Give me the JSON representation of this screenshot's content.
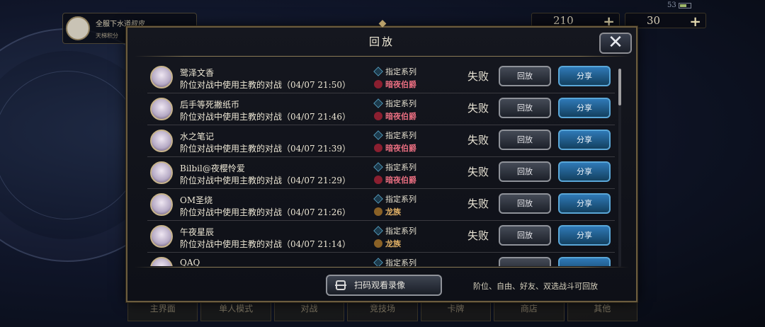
{
  "background": {
    "player_title": "全服下水道叔皮",
    "player_sub": "天梯积分",
    "currency": [
      {
        "name": "gold",
        "value": "210"
      },
      {
        "name": "crystal",
        "value": "30"
      }
    ],
    "battery": "53",
    "nav": [
      "主界面",
      "单人模式",
      "对战",
      "竞技场",
      "卡牌",
      "商店",
      "其他"
    ]
  },
  "dialog": {
    "title": "回放",
    "close_icon": "close-icon",
    "replay_label": "回放",
    "share_label": "分享",
    "qr_button": "扫码观看录像",
    "hint": "阶位、自由、好友、双选战斗可回放"
  },
  "replays": [
    {
      "name": "鹭泽文香",
      "desc": "阶位对战中使用主教的对战（04/07 21:50）",
      "deck": "指定系列",
      "opponent": "暗夜伯爵",
      "opp_type": "bat",
      "result": "失败"
    },
    {
      "name": "后手等死撇纸币",
      "desc": "阶位对战中使用主教的对战（04/07 21:46）",
      "deck": "指定系列",
      "opponent": "暗夜伯爵",
      "opp_type": "bat",
      "result": "失败"
    },
    {
      "name": "水之笔记",
      "desc": "阶位对战中使用主教的对战（04/07 21:39）",
      "deck": "指定系列",
      "opponent": "暗夜伯爵",
      "opp_type": "bat",
      "result": "失败"
    },
    {
      "name": "Bilbil@夜樱怜爱",
      "desc": "阶位对战中使用主教的对战（04/07 21:29）",
      "deck": "指定系列",
      "opponent": "暗夜伯爵",
      "opp_type": "bat",
      "result": "失败"
    },
    {
      "name": "OM圣烧",
      "desc": "阶位对战中使用主教的对战（04/07 21:26）",
      "deck": "指定系列",
      "opponent": "龙族",
      "opp_type": "dra",
      "result": "失败"
    },
    {
      "name": "午夜星辰",
      "desc": "阶位对战中使用主教的对战（04/07 21:14）",
      "deck": "指定系列",
      "opponent": "龙族",
      "opp_type": "dra",
      "result": "失败"
    },
    {
      "name": "QAQ",
      "desc": "",
      "deck": "指定系列",
      "opponent": "",
      "opp_type": "dra",
      "result": ""
    }
  ]
}
